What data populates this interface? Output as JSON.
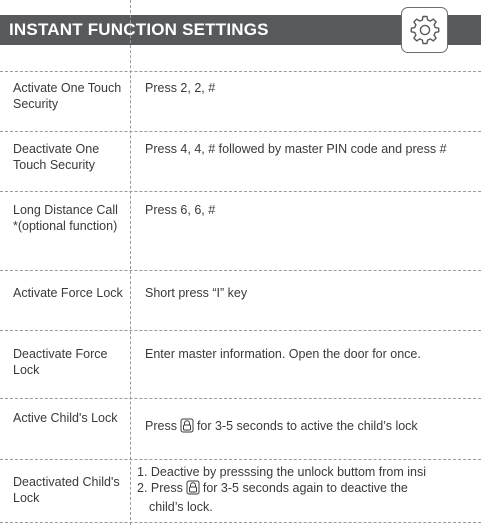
{
  "header": {
    "title": "INSTANT FUNCTION SETTINGS",
    "icon": "gear-icon"
  },
  "rows": [
    {
      "label": "Activate One Touch Security",
      "content": "Press 2, 2, #"
    },
    {
      "label": "Deactivate One Touch Security",
      "content": "Press 4, 4, # followed by master PIN code and press #"
    },
    {
      "label": "Long Distance Call *(optional function)",
      "content": "Press 6, 6, #"
    },
    {
      "label": "Activate Force Lock",
      "content": "Short press “I” key"
    },
    {
      "label": "Deactivate Force Lock",
      "content": "Enter master information. Open the door for once."
    },
    {
      "label": "Active Child's Lock",
      "content_before": "Press",
      "content_after": "for 3-5 seconds to active the child’s lock"
    },
    {
      "label": "Deactivated Child's Lock",
      "list": [
        {
          "text": "1. Deactive by presssing the unlock buttom from insi"
        },
        {
          "before": "2. Press",
          "after": "for 3-5 seconds again to deactive the"
        },
        {
          "text": "child’s lock."
        }
      ]
    }
  ],
  "colors": {
    "header_bg": "#58595b",
    "text": "#3a3a3a",
    "divider": "#9a9a9a"
  }
}
